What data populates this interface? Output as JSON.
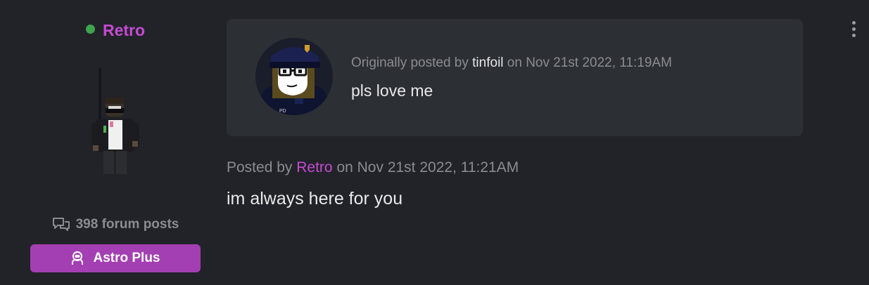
{
  "colors": {
    "background": "#212329",
    "quote_background": "#2c2f34",
    "username_accent": "#c54bd1",
    "online_status": "#3fa34d",
    "rank_badge": "#a43fb3",
    "muted_text": "#8a8c92",
    "body_text": "#e8e8e8"
  },
  "author": {
    "name": "Retro",
    "status": "online",
    "avatar_icon": "avatar-character-icon",
    "post_count": "398 forum posts",
    "post_count_icon": "chat-bubbles-icon",
    "rank_label": "Astro Plus",
    "rank_icon": "astronaut-icon"
  },
  "quote": {
    "avatar_icon": "police-avatar-icon",
    "prefix": "Originally posted by",
    "user": "tinfoil",
    "date_text": "on Nov 21st 2022, 11:19AM",
    "body": "pls love me"
  },
  "post": {
    "prefix": "Posted by",
    "user": "Retro",
    "date_text": "on Nov 21st 2022, 11:21AM",
    "body": "im always here for you"
  },
  "menu": {
    "icon": "more-vertical-icon"
  }
}
